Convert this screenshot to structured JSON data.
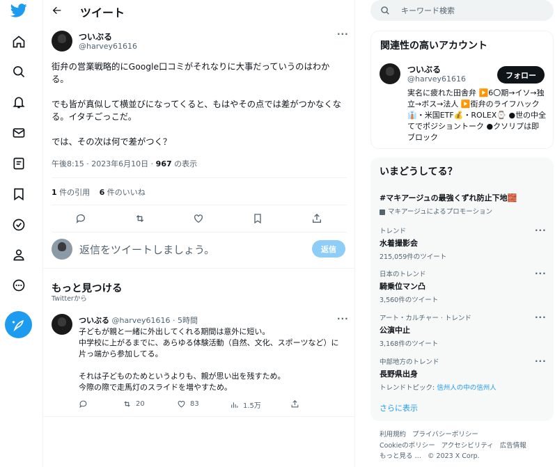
{
  "header": {
    "title": "ツイート"
  },
  "tweet": {
    "name": "ついぶる",
    "handle": "@harvey61616",
    "paragraphs": [
      "街弁の営業戦略的にGoogle口コミがそれなりに大事だっていうのはわかる。",
      "でも皆が真似して横並びになってくると、もはやその点では差がつかなくなる。イタチごっこだ。",
      "では、その次は何で差がつく？"
    ],
    "time": "午後8:15 · 2023年6月10日 · ",
    "views": "967",
    "views_label": " の表示",
    "quotes_count": "1",
    "quotes_label": " 件の引用",
    "likes_count": "6",
    "likes_label": " 件のいいね"
  },
  "reply": {
    "placeholder": "返信をツイートしましょう。",
    "button": "返信"
  },
  "discover": {
    "title": "もっと見つける",
    "subtitle": "Twitterから",
    "tweet": {
      "name": "ついぶる",
      "handle": "@harvey61616 · 5時間",
      "lines": [
        "子どもが親と一緒に外出してくれる期間は意外に短い。",
        "中学校に上がるまでに、あらゆる体験活動（自然、文化、スポーツなど）に",
        "片っ端から参加してる。",
        "",
        "それは子どものためというよりも、親が思い出を残すため。",
        "今際の際で走馬灯のスライドを増やすため。"
      ],
      "retweets": "20",
      "likes": "83",
      "views": "1.5万"
    }
  },
  "search": {
    "placeholder": "キーワード検索"
  },
  "related": {
    "title": "関連性の高いアカウント",
    "name": "ついぶる",
    "handle": "@harvey61616",
    "follow": "フォロー",
    "bio": "実名に疲れた田舎弁 ▶️6〇期→イソ→独立→ボス→法人 ▶️街弁のライフハック👔・米国ETF💰・ROLEX⌚ ●世の中全てでポジショントーク ●クソリプは即ブロック"
  },
  "trends": {
    "title": "いまどうしてる？",
    "promo": {
      "name": "#マキアージュの最強くずれ防止下地🧱",
      "label": "マキアージュによるプロモーション"
    },
    "items": [
      {
        "context": "トレンド",
        "name": "水着撮影会",
        "count": "215,059件のツイート"
      },
      {
        "context": "日本のトレンド",
        "name": "騎乗位マン凸",
        "count": "3,560件のツイート"
      },
      {
        "context": "アート・カルチャー · トレンド",
        "name": "公演中止",
        "count": "3,168件のツイート"
      },
      {
        "context": "中部地方のトレンド",
        "name": "長野県出身",
        "topic_label": "トレンドトピック: ",
        "topic": "信州人の中の信州人"
      }
    ],
    "more": "さらに表示"
  },
  "footer": {
    "links": [
      "利用規約",
      "プライバシーポリシー",
      "Cookieのポリシー",
      "アクセシビリティ",
      "広告情報",
      "もっと見る …"
    ],
    "copyright": "© 2023 X Corp."
  },
  "colors": {
    "accent": "#1d9bf0",
    "text": "#0f1419",
    "muted": "#536471"
  }
}
